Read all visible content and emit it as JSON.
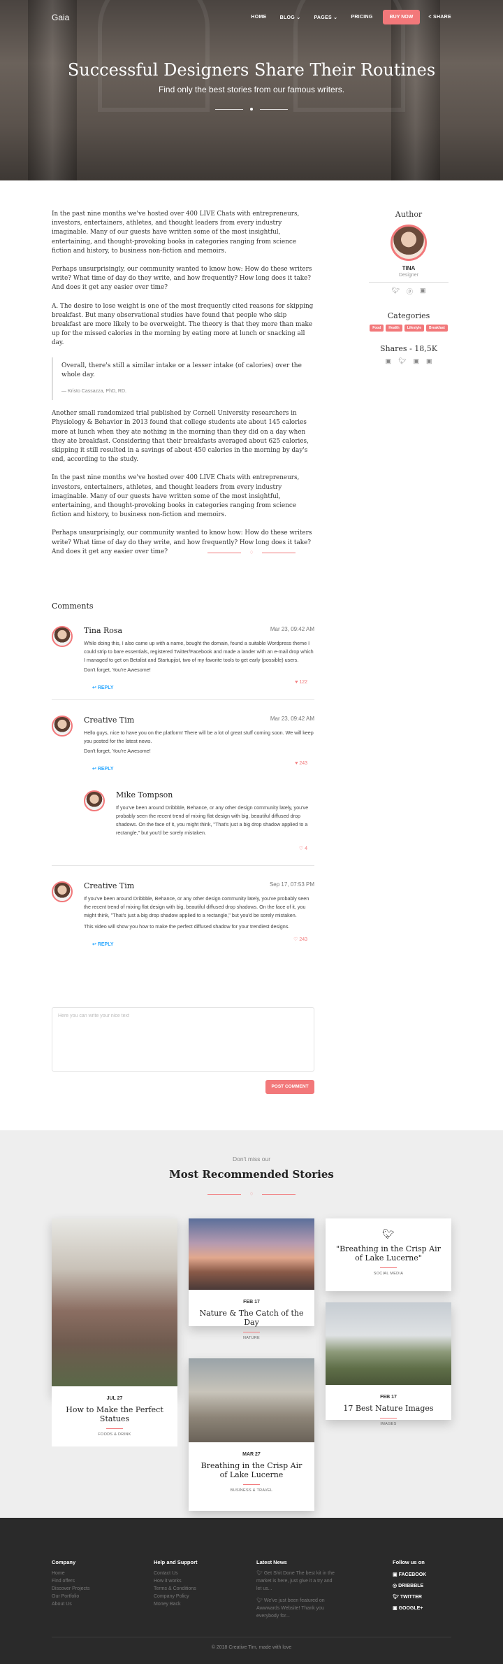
{
  "nav": {
    "brand": "Gaia",
    "links": [
      "HOME",
      "BLOG ⌄",
      "PAGES ⌄",
      "PRICING"
    ],
    "buy_now": "BUY NOW",
    "share": "SHARE"
  },
  "hero": {
    "title": "Successful Designers Share Their Routines",
    "subtitle": "Find only the best stories from our famous writers."
  },
  "article": {
    "p1": "In the past nine months we've hosted over 400 LIVE Chats with entrepreneurs, investors, entertainers, athletes, and thought leaders from every industry imaginable. Many of our guests have written some of the most insightful, entertaining, and thought-provoking books in categories ranging from science fiction and history, to business non-fiction and memoirs.",
    "p2": "Perhaps unsurprisingly, our community wanted to know how: How do these writers write? What time of day do they write, and how frequently? How long does it take? And does it get any easier over time?",
    "p3": "A. The desire to lose weight is one of the most frequently cited reasons for skipping breakfast. But many observational studies have found that people who skip breakfast are more likely to be overweight. The theory is that they more than make up for the missed calories in the morning by eating more at lunch or snacking all day.",
    "quote": "Overall, there's still a similar intake or a lesser intake (of calories) over the whole day.",
    "quote_author": "— Kristo Cassazza, PhD, RD.",
    "p4": "Another small randomized trial published by Cornell University researchers in Physiology & Behavior in 2013 found that college students ate about 145 calories more at lunch when they ate nothing in the morning than they did on a day when they ate breakfast. Considering that their breakfasts averaged about 625 calories, skipping it still resulted in a savings of about 450 calories in the morning by day's end, according to the study.",
    "p5": "In the past nine months we've hosted over 400 LIVE Chats with entrepreneurs, investors, entertainers, athletes, and thought leaders from every industry imaginable. Many of our guests have written some of the most insightful, entertaining, and thought-provoking books in categories ranging from science fiction and history, to business non-fiction and memoirs.",
    "p6": "Perhaps unsurprisingly, our community wanted to know how: How do these writers write? What time of day do they write, and how frequently? How long does it take? And does it get any easier over time?"
  },
  "sidebar": {
    "author_title": "Author",
    "author_name": "TINA",
    "author_role": "Designer",
    "categories_title": "Categories",
    "tags": [
      "Food",
      "Health",
      "Lifestyle",
      "Breakfast"
    ],
    "shares_title": "Shares - 18,5K"
  },
  "comments": {
    "title": "Comments",
    "items": [
      {
        "name": "Tina Rosa",
        "date": "Mar 23, 09:42 AM",
        "text": "While doing this, I also came up with a name, bought the domain, found a suitable Wordpress theme I could strip to bare essentials, registered Twitter/Facebook and made a lander with an e-mail drop which I managed to get on Betalist and Startupjist, two of my favorite tools to get early (possible) users.",
        "text2": "Don't forget, You're Awesome!",
        "reply": "REPLY",
        "likes": "♥ 122"
      },
      {
        "name": "Creative Tim",
        "date": "Mar 23, 09:42 AM",
        "text": "Hello guys, nice to have you on the platform! There will be a lot of great stuff coming soon. We will keep you posted for the latest news.",
        "text2": "Don't forget, You're Awesome!",
        "reply": "REPLY",
        "likes": "♥ 243"
      },
      {
        "name": "Mike Tompson",
        "date": "",
        "text": "If you've been around Dribbble, Behance, or any other design community lately, you've probably seen the recent trend of mixing flat design with big, beautiful diffused drop shadows. On the face of it, you might think, \"That's just a big drop shadow applied to a rectangle,\" but you'd be sorely mistaken.",
        "text2": "",
        "reply": "",
        "likes": "♡ 4"
      },
      {
        "name": "Creative Tim",
        "date": "Sep 17, 07:53 PM",
        "text": "If you've been around Dribbble, Behance, or any other design community lately, you've probably seen the recent trend of mixing flat design with big, beautiful diffused drop shadows. On the face of it, you might think, \"That's just a big drop shadow applied to a rectangle,\" but you'd be sorely mistaken.",
        "text2": "This video will show you how to make the perfect diffused shadow for your trendiest designs.",
        "reply": "REPLY",
        "likes": "♡ 243"
      }
    ],
    "placeholder": "Here you can write your nice text",
    "post_button": "POST COMMENT"
  },
  "recommended": {
    "kicker": "Don't miss our",
    "title": "Most Recommended Stories",
    "cards": [
      {
        "date": "JUL 27",
        "title": "How to Make the Perfect Statues",
        "category": "FOODS & DRINK"
      },
      {
        "date": "FEB 17",
        "title": "Nature & The Catch of the Day",
        "category": "NATURE"
      },
      {
        "date": "MAR 27",
        "title": "Breathing in the Crisp Air of Lake Lucerne",
        "category": "BUSINESS & TRAVEL"
      },
      {
        "date": "",
        "title": "\"Breathing in the Crisp Air of Lake Lucerne\"",
        "category": "SOCIAL MEDIA"
      },
      {
        "date": "FEB 17",
        "title": "17 Best Nature Images",
        "category": "IMAGES"
      }
    ]
  },
  "footer": {
    "company": {
      "title": "Company",
      "links": [
        "Home",
        "Find offers",
        "Discover Projects",
        "Our Portfolio",
        "About Us"
      ]
    },
    "help": {
      "title": "Help and Support",
      "links": [
        "Contact Us",
        "How it works",
        "Terms & Conditions",
        "Company Policy",
        "Money Back"
      ]
    },
    "news": {
      "title": "Latest News",
      "item1": "Get Shit Done The best kit in the market is here, just give it a try and let us...",
      "item2": "We've just been featured on Awwwards Website! Thank you everybody for..."
    },
    "follow": {
      "title": "Follow us on",
      "links": [
        "FACEBOOK",
        "DRIBBBLE",
        "TWITTER",
        "GOOGLE+"
      ]
    },
    "copyright": "© 2018 Creative Tim, made with love"
  }
}
